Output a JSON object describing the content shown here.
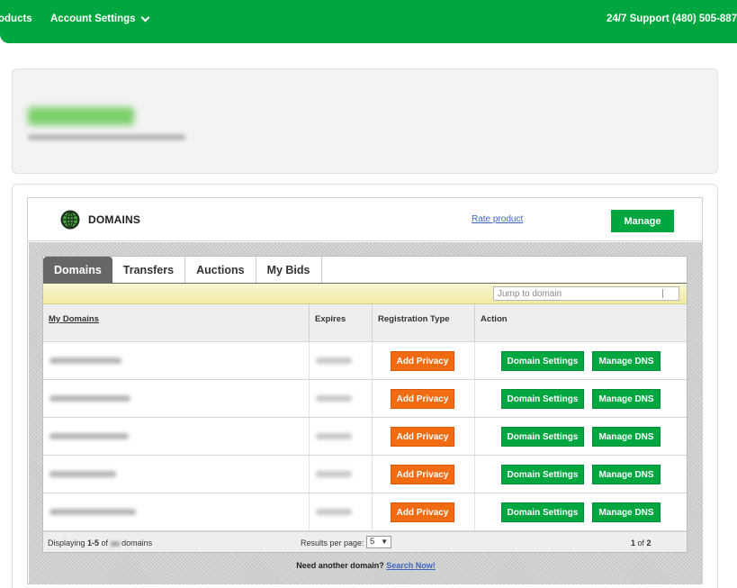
{
  "topbar": {
    "products": "oducts",
    "account_settings": "Account Settings",
    "support": "24/7 Support (480) 505-887"
  },
  "widget": {
    "title": "DOMAINS",
    "rate_link": "Rate product",
    "manage_button": "Manage"
  },
  "tabs": [
    {
      "label": "Domains",
      "active": true
    },
    {
      "label": "Transfers",
      "active": false
    },
    {
      "label": "Auctions",
      "active": false
    },
    {
      "label": "My Bids",
      "active": false
    }
  ],
  "jump": {
    "placeholder": "Jump to domain"
  },
  "table": {
    "columns": [
      "My Domains",
      "Expires",
      "Registration Type",
      "Action"
    ],
    "rows": [
      {
        "privacy": "Add Privacy",
        "settings": "Domain Settings",
        "dns": "Manage DNS"
      },
      {
        "privacy": "Add Privacy",
        "settings": "Domain Settings",
        "dns": "Manage DNS"
      },
      {
        "privacy": "Add Privacy",
        "settings": "Domain Settings",
        "dns": "Manage DNS"
      },
      {
        "privacy": "Add Privacy",
        "settings": "Domain Settings",
        "dns": "Manage DNS"
      },
      {
        "privacy": "Add Privacy",
        "settings": "Domain Settings",
        "dns": "Manage DNS"
      }
    ]
  },
  "footer": {
    "displaying_prefix": "Displaying ",
    "displaying_range": "1-5",
    "displaying_of": " of ",
    "displaying_suffix": " domains",
    "results_per_page_label": "Results per page:",
    "results_per_page_value": "5",
    "page_current": "1",
    "page_of": " of ",
    "page_total": "2"
  },
  "another": {
    "text": "Need another domain? ",
    "link": "Search Now!"
  },
  "colors": {
    "brand_green": "#00a63f",
    "privacy_orange": "#f06b12",
    "link_blue": "#3d66c2"
  }
}
